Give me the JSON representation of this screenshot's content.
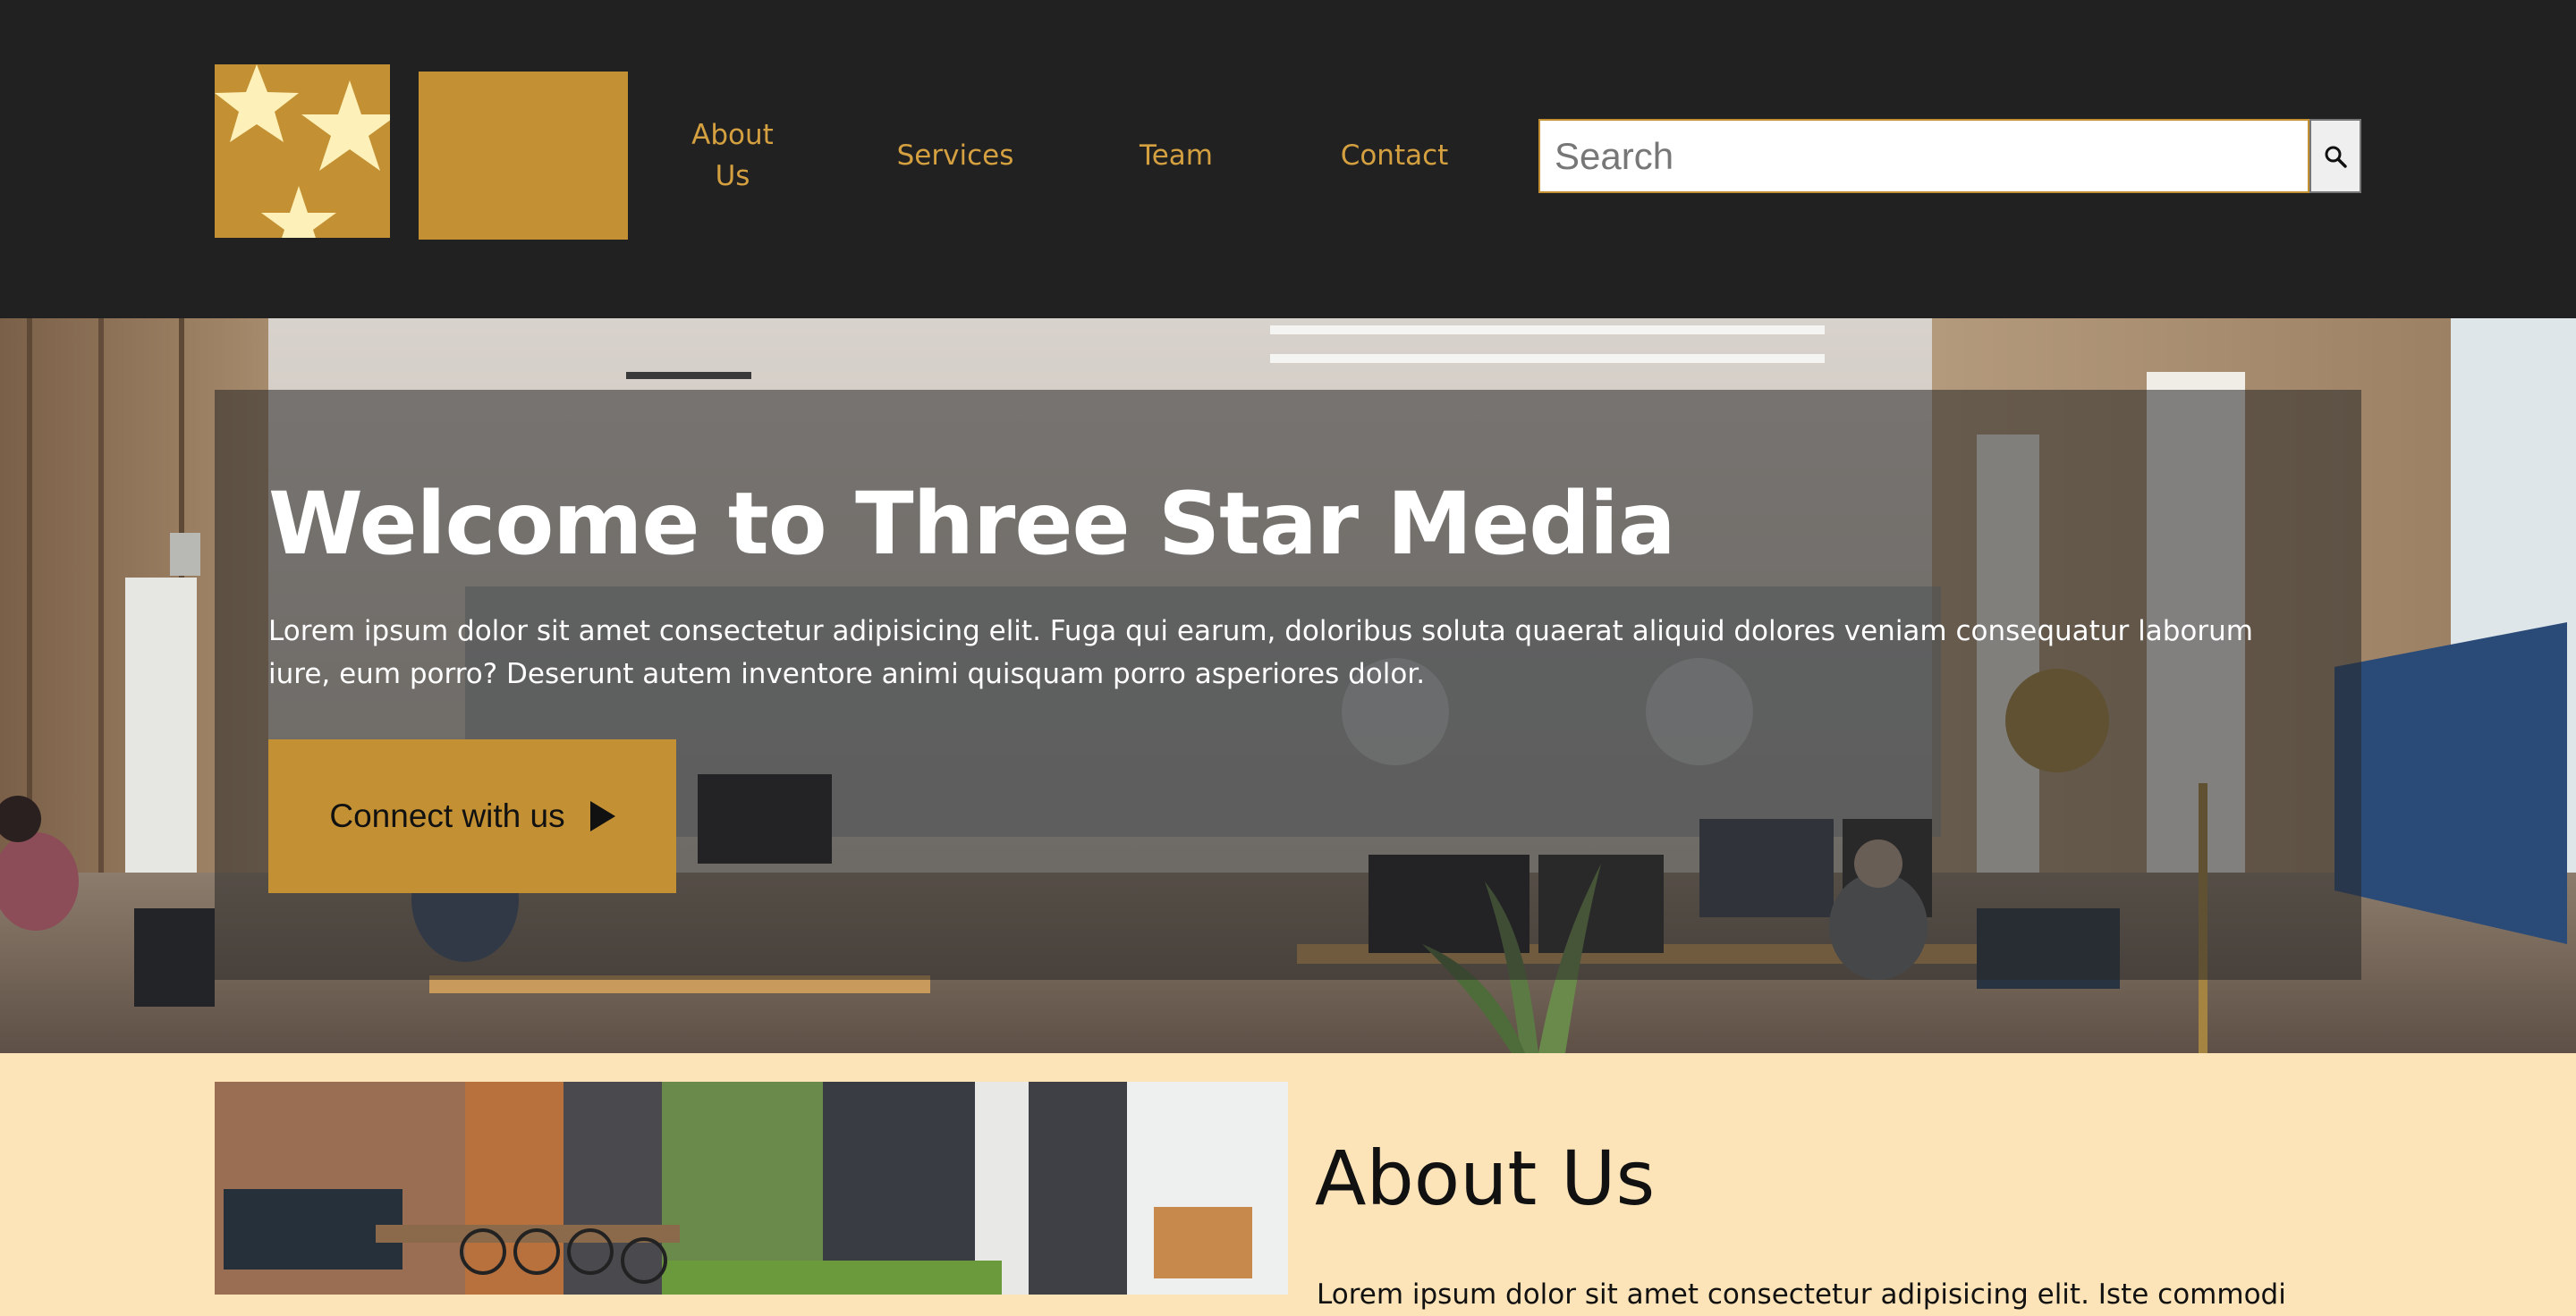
{
  "header": {
    "nav": {
      "about": "About Us",
      "services": "Services",
      "team": "Team",
      "contact": "Contact"
    },
    "search": {
      "placeholder": "Search",
      "value": "",
      "button_icon": "search-icon"
    }
  },
  "hero": {
    "title": "Welcome to Three Star Media",
    "text": "Lorem ipsum dolor sit amet consectetur adipisicing elit. Fuga qui earum, doloribus soluta quaerat aliquid dolores veniam consequatur laborum iure, eum porro? Deserunt autem inventore animi quisquam porro asperiores dolor.",
    "cta_label": "Connect with us",
    "cta_icon": "play-icon"
  },
  "about": {
    "title": "About Us",
    "text": "Lorem ipsum dolor sit amet consectetur adipisicing elit. Iste commodi"
  },
  "colors": {
    "header_bg": "#212121",
    "accent": "#c39133",
    "nav_text": "#d4a040",
    "about_bg": "#fce4b8",
    "star": "#fdf0b8"
  }
}
